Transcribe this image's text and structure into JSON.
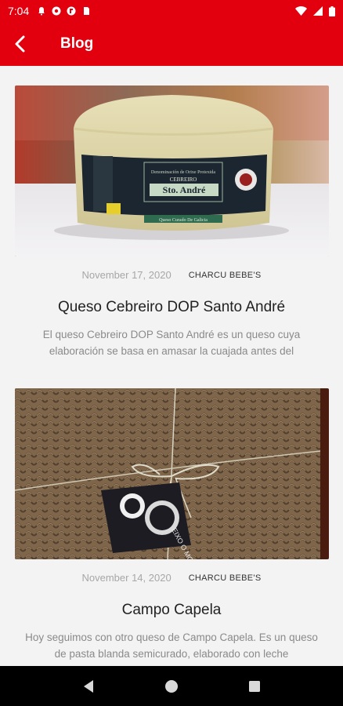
{
  "status_bar": {
    "time": "7:04",
    "icons": [
      "notification-icon",
      "sync-icon",
      "app-icon",
      "sd-card-icon",
      "wifi-icon",
      "cellular-signal-icon",
      "battery-icon"
    ]
  },
  "app_bar": {
    "title": "Blog",
    "back_icon": "back-arrow-icon"
  },
  "posts": [
    {
      "date": "November 17, 2020",
      "author": "CHARCU BEBE'S",
      "title": "Queso Cebreiro DOP Santo André",
      "excerpt": "El queso Cebreiro DOP Santo André es un queso cuya elaboración se basa en amasar la cuajada antes del",
      "image_label": {
        "line1": "Denominación de Orixe Protexida",
        "line2": "CEBREIRO",
        "brand": "Sto. André",
        "line4": "Queso Curado De Galicia"
      }
    },
    {
      "date": "November 14, 2020",
      "author": "CHARCU BEBE'S",
      "title": "Campo Capela",
      "excerpt": "Hoy seguimos con otro queso de Campo Capela. Es un queso de pasta blanda semicurado, elaborado con leche",
      "image_label": {
        "brand": "EIXO O MOURO"
      }
    }
  ],
  "colors": {
    "primary": "#e2000f",
    "background": "#f3f3f3"
  },
  "nav_bar": {
    "icons": [
      "back-triangle-icon",
      "home-circle-icon",
      "recents-square-icon"
    ]
  }
}
